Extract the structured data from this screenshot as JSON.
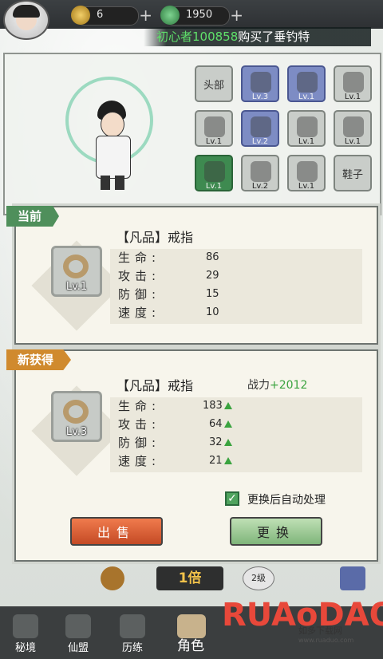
{
  "resources": {
    "silver": "6",
    "jade": "1950",
    "add": "+"
  },
  "ticker": {
    "name": "初心者100858",
    "text": "购买了垂钓特"
  },
  "equip_slots": [
    {
      "label": "头部",
      "level": "",
      "style": "plain"
    },
    {
      "label": "",
      "level": "Lv.3",
      "style": "blue"
    },
    {
      "label": "",
      "level": "Lv.1",
      "style": "blue"
    },
    {
      "label": "",
      "level": "Lv.1",
      "style": "plain"
    },
    {
      "label": "",
      "level": "Lv.1",
      "style": "plain"
    },
    {
      "label": "",
      "level": "Lv.2",
      "style": "blue"
    },
    {
      "label": "",
      "level": "Lv.1",
      "style": "plain"
    },
    {
      "label": "",
      "level": "Lv.1",
      "style": "plain"
    },
    {
      "label": "",
      "level": "Lv.1",
      "style": "green"
    },
    {
      "label": "",
      "level": "Lv.2",
      "style": "plain"
    },
    {
      "label": "",
      "level": "Lv.1",
      "style": "plain"
    },
    {
      "label": "鞋子",
      "level": "",
      "style": "plain"
    }
  ],
  "current": {
    "tag": "当前",
    "title": "【凡品】戒指",
    "icon_level": "Lv.1",
    "stats": [
      {
        "label": "生命:",
        "value": "86"
      },
      {
        "label": "攻击:",
        "value": "29"
      },
      {
        "label": "防御:",
        "value": "15"
      },
      {
        "label": "速度:",
        "value": "10"
      }
    ]
  },
  "new_item": {
    "tag": "新获得",
    "title": "【凡品】戒指",
    "icon_level": "Lv.3",
    "power_label": "战力",
    "power_delta": "+2012",
    "stats": [
      {
        "label": "生命:",
        "value": "183"
      },
      {
        "label": "攻击:",
        "value": "64"
      },
      {
        "label": "防御:",
        "value": "32"
      },
      {
        "label": "速度:",
        "value": "21"
      }
    ],
    "auto_label": "更换后自动处理",
    "auto_checked": true,
    "sell_label": "出售",
    "swap_label": "更换"
  },
  "controls": {
    "speed": "1倍",
    "level": "2级"
  },
  "bottom_nav": [
    {
      "label": "秘境"
    },
    {
      "label": "仙盟"
    },
    {
      "label": "历练"
    },
    {
      "label": "角色"
    }
  ],
  "watermark": {
    "big": "RUAoDAO",
    "sub": "如多下载网",
    "url": "www.ruaduo.com"
  },
  "colors": {
    "green_tag": "#4f8f5b",
    "orange_tag": "#d08a2e",
    "sell": "#e0683d",
    "swap": "#9fcb98",
    "power_plus": "#3aa33f"
  }
}
